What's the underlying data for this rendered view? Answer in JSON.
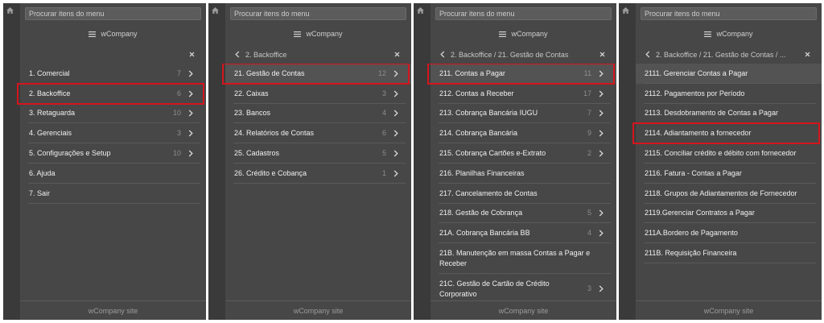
{
  "search": {
    "placeholder": "Procurar itens do menu"
  },
  "brand": {
    "name": "wCompany"
  },
  "footer": {
    "label": "wCompany site"
  },
  "icons": {
    "home": "home-icon",
    "menu_toggle": "hamburger-icon",
    "back": "chevron-left-icon",
    "close": "close-icon",
    "submenu": "chevron-right-icon"
  },
  "colors": {
    "panel_bg": "#474747",
    "strip_bg": "#3a3a3a",
    "text": "#f1f1f1",
    "muted": "#8d8d8d",
    "marker": "#d4151d"
  },
  "panels": [
    {
      "breadcrumb": "",
      "items": [
        {
          "label": "1. Comercial",
          "count": 7
        },
        {
          "label": "2. Backoffice",
          "count": 6,
          "marked": true
        },
        {
          "label": "3. Retaguarda",
          "count": 10
        },
        {
          "label": "4. Gerenciais",
          "count": 3
        },
        {
          "label": "5. Configurações e Setup",
          "count": 10
        },
        {
          "label": "6. Ajuda"
        },
        {
          "label": "7. Sair"
        }
      ]
    },
    {
      "breadcrumb": "2. Backoffice",
      "items": [
        {
          "label": "21. Gestão de Contas",
          "count": 12,
          "marked": true,
          "hover": true
        },
        {
          "label": "22. Caixas",
          "count": 3
        },
        {
          "label": "23. Bancos",
          "count": 4
        },
        {
          "label": "24. Relatórios de Contas",
          "count": 6
        },
        {
          "label": "25. Cadastros",
          "count": 5
        },
        {
          "label": "26. Crédito e Cobança",
          "count": 1
        }
      ]
    },
    {
      "breadcrumb": "2. Backoffice / 21. Gestão de Contas",
      "items": [
        {
          "label": "211. Contas a Pagar",
          "count": 11,
          "marked": true,
          "hover": true
        },
        {
          "label": "212. Contas a Receber",
          "count": 17
        },
        {
          "label": "213. Cobrança Bancária IUGU",
          "count": 7
        },
        {
          "label": "214. Cobrança Bancária",
          "count": 9
        },
        {
          "label": "215. Cobrança Cartões e-Extrato",
          "count": 2
        },
        {
          "label": "216. Planilhas Financeiras"
        },
        {
          "label": "217. Cancelamento de Contas"
        },
        {
          "label": "218. Gestão de Cobrança",
          "count": 5
        },
        {
          "label": "21A. Cobrança Bancária BB",
          "count": 4
        },
        {
          "label": "21B. Manutenção em massa Contas a Pagar e Receber"
        },
        {
          "label": "21C. Gestão de Cartão de Crédito Corporativo",
          "count": 3
        }
      ]
    },
    {
      "breadcrumb": "2. Backoffice / 21. Gestão de Contas / ...",
      "items": [
        {
          "label": "2111. Gerenciar Contas a Pagar",
          "hover": true
        },
        {
          "label": "2112. Pagamentos por Período"
        },
        {
          "label": "2113. Desdobramento de Contas a Pagar"
        },
        {
          "label": "2114. Adiantamento a fornecedor",
          "marked": true
        },
        {
          "label": "2115. Conciliar crédito e débito com fornecedor"
        },
        {
          "label": "2116. Fatura - Contas a Pagar"
        },
        {
          "label": "2118. Grupos de Adiantamentos de Fornecedor"
        },
        {
          "label": "2119.Gerenciar Contratos a Pagar"
        },
        {
          "label": "211A.Bordero de Pagamento"
        },
        {
          "label": "211B. Requisição Financeira"
        }
      ]
    }
  ]
}
